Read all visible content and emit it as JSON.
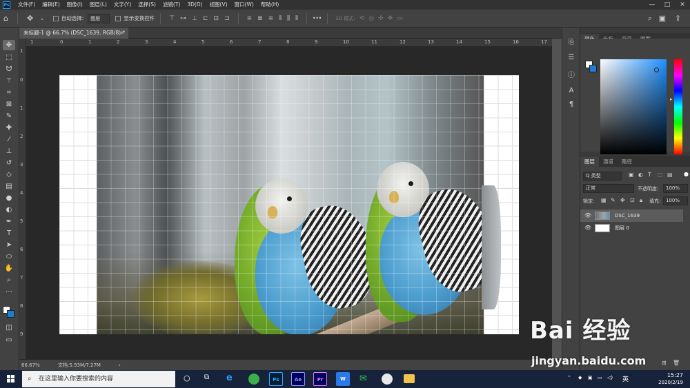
{
  "menubar": {
    "app_icon": "Ps",
    "items": [
      "文件(F)",
      "编辑(E)",
      "图像(I)",
      "图层(L)",
      "文字(Y)",
      "选择(S)",
      "滤镜(T)",
      "3D(D)",
      "视图(V)",
      "窗口(W)",
      "帮助(H)"
    ],
    "window_controls": [
      "—",
      "□",
      "✕"
    ]
  },
  "options_bar": {
    "auto_select_label": "自动选择:",
    "auto_select_value": "图层",
    "show_transform_label": "显示变换控件",
    "mode_3d_label": "3D 模式:",
    "more_label": "•••"
  },
  "document": {
    "tab_title": "未标题-1 @ 66.7% (DSC_1639, RGB/8) *",
    "close_glyph": "×"
  },
  "rulers": {
    "top": [
      "1",
      "0",
      "1",
      "2",
      "3",
      "4",
      "5",
      "6",
      "7",
      "8",
      "9",
      "10",
      "11",
      "12",
      "13",
      "14",
      "15",
      "16",
      "17"
    ],
    "left": [
      "1",
      "0",
      "1",
      "2",
      "3",
      "4",
      "5",
      "6",
      "7",
      "8",
      "9"
    ]
  },
  "statusbar": {
    "zoom": "66.67%",
    "doc_info": "文档:5.93M/7.27M",
    "arrow": "›"
  },
  "panels": {
    "color_tabs": [
      "颜色",
      "色板",
      "渐变",
      "图案"
    ],
    "layers_tabs": [
      "图层",
      "通道",
      "路径"
    ],
    "filter_label": "Q 类型",
    "blend_mode": "正常",
    "opacity_label": "不透明度:",
    "opacity_value": "100%",
    "lock_label": "锁定:",
    "fill_label": "填充:",
    "fill_value": "100%",
    "layers": [
      {
        "name": "DSC_1639",
        "selected": true
      },
      {
        "name": "图层 0",
        "selected": false
      }
    ]
  },
  "taskbar": {
    "search_placeholder": "在这里输入你要搜索的内容",
    "apps": [
      "Ps",
      "Ae",
      "Pr",
      "W"
    ],
    "ime": "英",
    "time": "15:27",
    "date": "2020/2/19"
  },
  "watermark": {
    "main": "Bai 经验",
    "url": "jingyan.baidu.com"
  },
  "colors": {
    "foreground": "#ffffff",
    "background": "#1c7ed6",
    "accent": "#31a8ff"
  }
}
